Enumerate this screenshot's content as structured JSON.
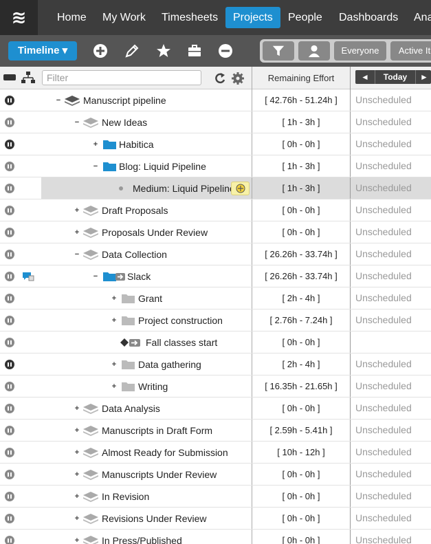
{
  "nav": {
    "items": [
      "Home",
      "My Work",
      "Timesheets",
      "Projects",
      "People",
      "Dashboards",
      "Ana"
    ],
    "active": "Projects"
  },
  "toolbar": {
    "timeline_label": "Timeline ▾",
    "everyone_label": "Everyone",
    "active_label": "Active It"
  },
  "columns": {
    "filter_placeholder": "Filter",
    "remaining_effort": "Remaining Effort",
    "today_label": "Today",
    "prev_arrow": "◄",
    "next_arrow": "►"
  },
  "rows": [
    {
      "label": "Manuscript pipeline",
      "effort": "[ 42.76h - 51.24h ]",
      "schedule": "Unscheduled",
      "level": 0,
      "toggle": "−",
      "icon": "stack-dark-icon",
      "pause": "dark"
    },
    {
      "label": "New Ideas",
      "effort": "[ 1h - 3h ]",
      "schedule": "Unscheduled",
      "level": 1,
      "toggle": "−",
      "icon": "stack-icon",
      "pause": "light"
    },
    {
      "label": "Habitica",
      "effort": "[ 0h - 0h ]",
      "schedule": "Unscheduled",
      "level": 2,
      "toggle": "+",
      "icon": "folder-blue-icon",
      "pause": "dark"
    },
    {
      "label": "Blog: Liquid Pipeline",
      "effort": "[ 1h - 3h ]",
      "schedule": "Unscheduled",
      "level": 2,
      "toggle": "−",
      "icon": "folder-blue-icon",
      "pause": "light"
    },
    {
      "label": "Medium: Liquid Pipeline",
      "effort": "[ 1h - 3h ]",
      "schedule": "Unscheduled",
      "level": 3,
      "toggle": "",
      "icon": "bullet",
      "pause": "light",
      "selected": true,
      "badge": true
    },
    {
      "label": "Draft Proposals",
      "effort": "[ 0h - 0h ]",
      "schedule": "Unscheduled",
      "level": 1,
      "toggle": "+",
      "icon": "stack-icon",
      "pause": "light"
    },
    {
      "label": "Proposals Under Review",
      "effort": "[ 0h - 0h ]",
      "schedule": "Unscheduled",
      "level": 1,
      "toggle": "+",
      "icon": "stack-icon",
      "pause": "light"
    },
    {
      "label": "Data Collection",
      "effort": "[ 26.26h - 33.74h ]",
      "schedule": "Unscheduled",
      "level": 1,
      "toggle": "−",
      "icon": "stack-icon",
      "pause": "light"
    },
    {
      "label": "Slack",
      "effort": "[ 26.26h - 33.74h ]",
      "schedule": "Unscheduled",
      "level": 2,
      "toggle": "−",
      "icon": "folder-blue-arrow-icon",
      "pause": "light",
      "comment": true
    },
    {
      "label": "Grant",
      "effort": "[ 2h - 4h ]",
      "schedule": "Unscheduled",
      "level": 3,
      "toggle": "+",
      "icon": "folder-gray-icon",
      "pause": "light"
    },
    {
      "label": "Project construction",
      "effort": "[ 2.76h - 7.24h ]",
      "schedule": "Unscheduled",
      "level": 3,
      "toggle": "+",
      "icon": "folder-gray-icon",
      "pause": "light"
    },
    {
      "label": "Fall classes start",
      "effort": "[ 0h - 0h ]",
      "schedule": "",
      "level": 3,
      "toggle": "",
      "icon": "milestone-icon",
      "pause": "light"
    },
    {
      "label": "Data gathering",
      "effort": "[ 2h - 4h ]",
      "schedule": "Unscheduled",
      "level": 3,
      "toggle": "+",
      "icon": "folder-gray-icon",
      "pause": "dark"
    },
    {
      "label": "Writing",
      "effort": "[ 16.35h - 21.65h ]",
      "schedule": "Unscheduled",
      "level": 3,
      "toggle": "+",
      "icon": "folder-gray-icon",
      "pause": "light"
    },
    {
      "label": "Data Analysis",
      "effort": "[ 0h - 0h ]",
      "schedule": "Unscheduled",
      "level": 1,
      "toggle": "+",
      "icon": "stack-icon",
      "pause": "light"
    },
    {
      "label": "Manuscripts in Draft Form",
      "effort": "[ 2.59h - 5.41h ]",
      "schedule": "Unscheduled",
      "level": 1,
      "toggle": "+",
      "icon": "stack-icon",
      "pause": "light"
    },
    {
      "label": "Almost Ready for Submission",
      "effort": "[ 10h - 12h ]",
      "schedule": "Unscheduled",
      "level": 1,
      "toggle": "+",
      "icon": "stack-icon",
      "pause": "light"
    },
    {
      "label": "Manuscripts Under Review",
      "effort": "[ 0h - 0h ]",
      "schedule": "Unscheduled",
      "level": 1,
      "toggle": "+",
      "icon": "stack-icon",
      "pause": "light"
    },
    {
      "label": "In Revision",
      "effort": "[ 0h - 0h ]",
      "schedule": "Unscheduled",
      "level": 1,
      "toggle": "+",
      "icon": "stack-icon",
      "pause": "light"
    },
    {
      "label": "Revisions Under Review",
      "effort": "[ 0h - 0h ]",
      "schedule": "Unscheduled",
      "level": 1,
      "toggle": "+",
      "icon": "stack-icon",
      "pause": "light"
    },
    {
      "label": "In Press/Published",
      "effort": "[ 0h - 0h ]",
      "schedule": "Unscheduled",
      "level": 1,
      "toggle": "+",
      "icon": "stack-icon",
      "pause": "light"
    }
  ],
  "colors": {
    "nav_bg": "#3d3d3d",
    "active_blue": "#1e8fd0",
    "toolbar_bg": "#555555",
    "selected_row": "#dcdcdc"
  }
}
